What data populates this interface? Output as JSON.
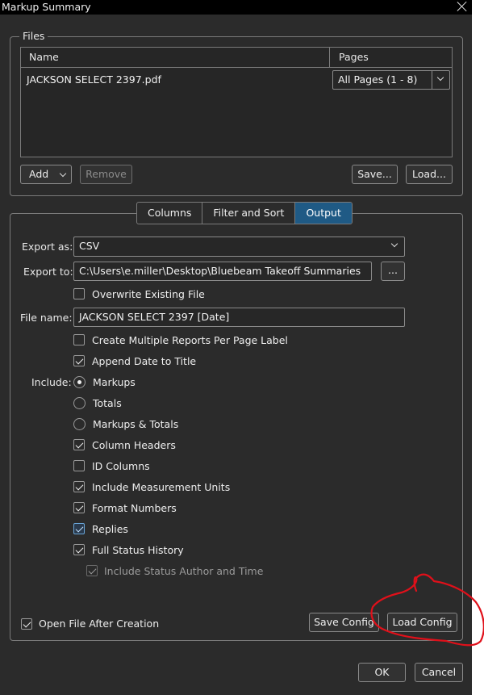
{
  "window": {
    "title": "Markup Summary"
  },
  "files": {
    "legend": "Files",
    "columns": {
      "name": "Name",
      "pages": "Pages"
    },
    "rows": [
      {
        "name": "JACKSON SELECT 2397.pdf",
        "pages": "All Pages (1 - 8)"
      }
    ],
    "buttons": {
      "add": "Add",
      "remove": "Remove",
      "save": "Save...",
      "load": "Load..."
    }
  },
  "tabs": [
    {
      "label": "Columns"
    },
    {
      "label": "Filter and Sort"
    },
    {
      "label": "Output"
    }
  ],
  "output": {
    "export_as_label": "Export as:",
    "export_as_value": "CSV",
    "export_to_label": "Export to:",
    "export_to_value": "C:\\Users\\e.miller\\Desktop\\Bluebeam Takeoff Summaries",
    "browse": "...",
    "overwrite": "Overwrite Existing File",
    "file_name_label": "File name:",
    "file_name_value": "JACKSON SELECT 2397 [Date]",
    "multiple_reports": "Create Multiple Reports Per Page Label",
    "append_date": "Append Date to Title",
    "include_label": "Include:",
    "include_options": [
      "Markups",
      "Totals",
      "Markups & Totals"
    ],
    "column_headers": "Column Headers",
    "id_columns": "ID Columns",
    "measurement_units": "Include Measurement Units",
    "format_numbers": "Format Numbers",
    "replies": "Replies",
    "full_status_history": "Full Status History",
    "status_author_time": "Include Status Author and Time",
    "open_after": "Open File After Creation",
    "save_config": "Save Config",
    "load_config": "Load Config"
  },
  "footer": {
    "ok": "OK",
    "cancel": "Cancel"
  },
  "colors": {
    "background": "#2b2b2b",
    "active_tab": "#1f5a85",
    "annotation": "#e0101a"
  }
}
